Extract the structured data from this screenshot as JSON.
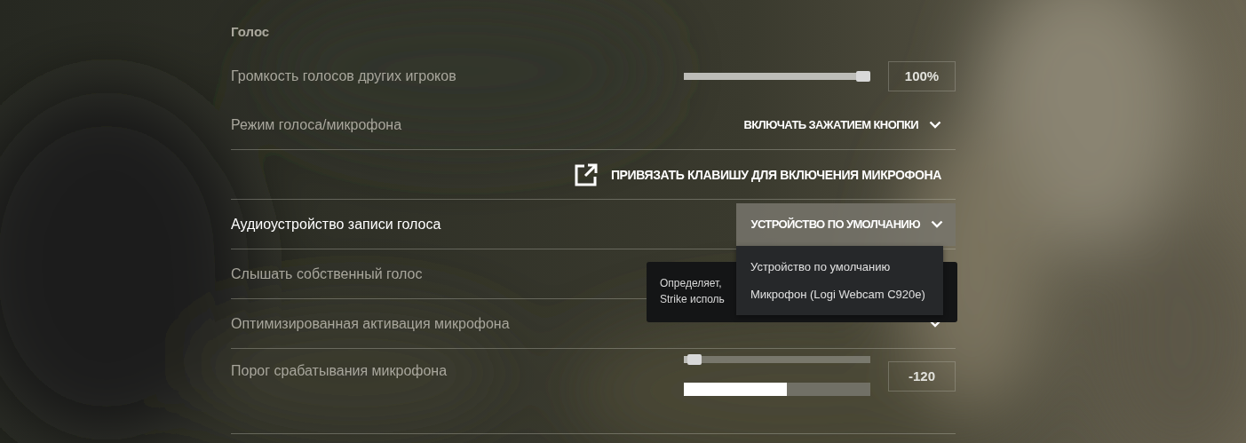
{
  "section": {
    "title": "Голос"
  },
  "rows": [
    {
      "kind": "slider",
      "label": "Громкость голосов других игроков",
      "highlighted": false,
      "level": 1,
      "reading": "100%"
    },
    {
      "kind": "select",
      "label": "Режим голоса/микрофона",
      "highlighted": false,
      "value": "ВКЛЮЧАТЬ ЗАЖАТИЕМ КНОПКИ",
      "open": false
    },
    {
      "kind": "link",
      "label": "ПРИВЯЗАТЬ КЛАВИШУ ДЛЯ ВКЛЮЧЕНИЯ МИКРОФОНА"
    },
    {
      "kind": "select",
      "label": "Аудиоустройство записи голоса",
      "highlighted": true,
      "value": "УСТРОЙСТВО ПО УМОЛЧАНИЮ",
      "open": true,
      "options": [
        "Устройство по умолчанию",
        "Микрофон (Logi Webcam C920e)"
      ]
    },
    {
      "kind": "plain",
      "label": "Слышать собственный голос",
      "highlighted": false
    },
    {
      "kind": "select",
      "label": "Оптимизированная активация микрофона",
      "highlighted": false,
      "open": false
    },
    {
      "kind": "threshold",
      "label": "Порог срабатывания микрофона",
      "highlighted": false,
      "level": 0.02,
      "reading": "-120",
      "meter": {
        "level": 0.55
      }
    }
  ],
  "tooltip": {
    "lines": [
      "Определяет,",
      "Strike исполь"
    ]
  }
}
